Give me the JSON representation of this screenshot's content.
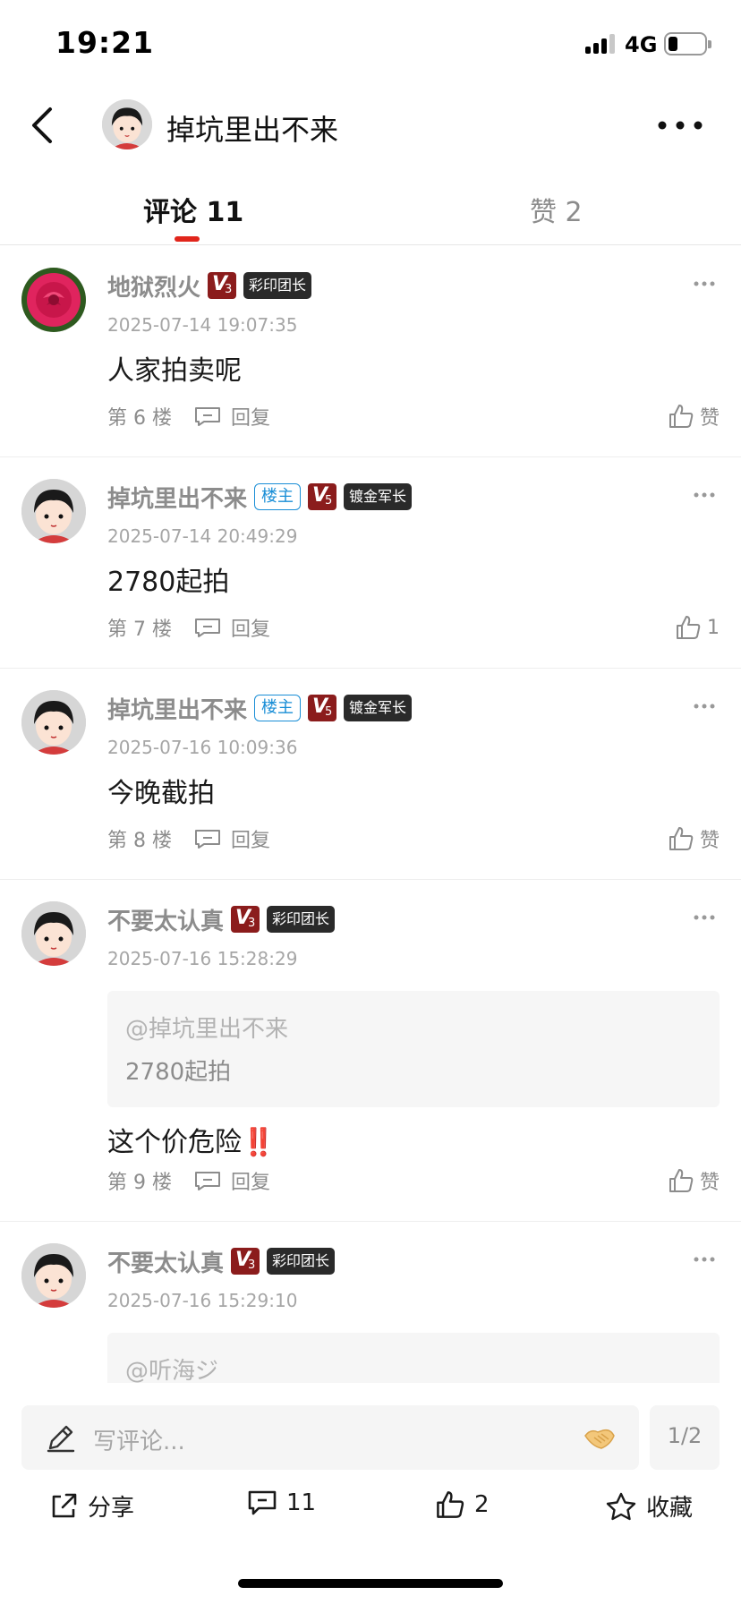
{
  "status_bar": {
    "time": "19:21",
    "network": "4G"
  },
  "header": {
    "title": "掉坑里出不来"
  },
  "tabs": {
    "comments": "评论 11",
    "likes": "赞 2"
  },
  "comments": [
    {
      "name": "地狱烈火",
      "host_badge": "",
      "vip_level": "3",
      "rank_badge": "彩印团长",
      "time": "2025-07-14 19:07:35",
      "text": "人家拍卖呢",
      "floor": "第 6 楼",
      "reply": "回复",
      "like": "赞"
    },
    {
      "name": "掉坑里出不来",
      "host_badge": "楼主",
      "vip_level": "5",
      "rank_badge": "镀金军长",
      "time": "2025-07-14 20:49:29",
      "text": "2780起拍",
      "floor": "第 7 楼",
      "reply": "回复",
      "like": "1"
    },
    {
      "name": "掉坑里出不来",
      "host_badge": "楼主",
      "vip_level": "5",
      "rank_badge": "镀金军长",
      "time": "2025-07-16 10:09:36",
      "text": "今晚截拍",
      "floor": "第 8 楼",
      "reply": "回复",
      "like": "赞"
    },
    {
      "name": "不要太认真",
      "host_badge": "",
      "vip_level": "3",
      "rank_badge": "彩印团长",
      "time": "2025-07-16 15:28:29",
      "quote_at": "@掉坑里出不来",
      "quote_text": "2780起拍",
      "text": "这个价危险",
      "text_emoji": "‼️",
      "floor": "第 9 楼",
      "reply": "回复",
      "like": "赞"
    },
    {
      "name": "不要太认真",
      "host_badge": "",
      "vip_level": "3",
      "rank_badge": "彩印团长",
      "time": "2025-07-16 15:29:10",
      "quote_at": "@听海ジ"
    }
  ],
  "input": {
    "placeholder": "写评论..."
  },
  "pagination": "1/2",
  "toolbar": {
    "share": "分享",
    "comments": "11",
    "likes": "2",
    "favorite": "收藏"
  },
  "colors": {
    "accent": "#e1251b",
    "host_badge": "#1a8ed6",
    "vip_badge": "#8b1c1c",
    "rank_badge": "#2a2a2a"
  }
}
